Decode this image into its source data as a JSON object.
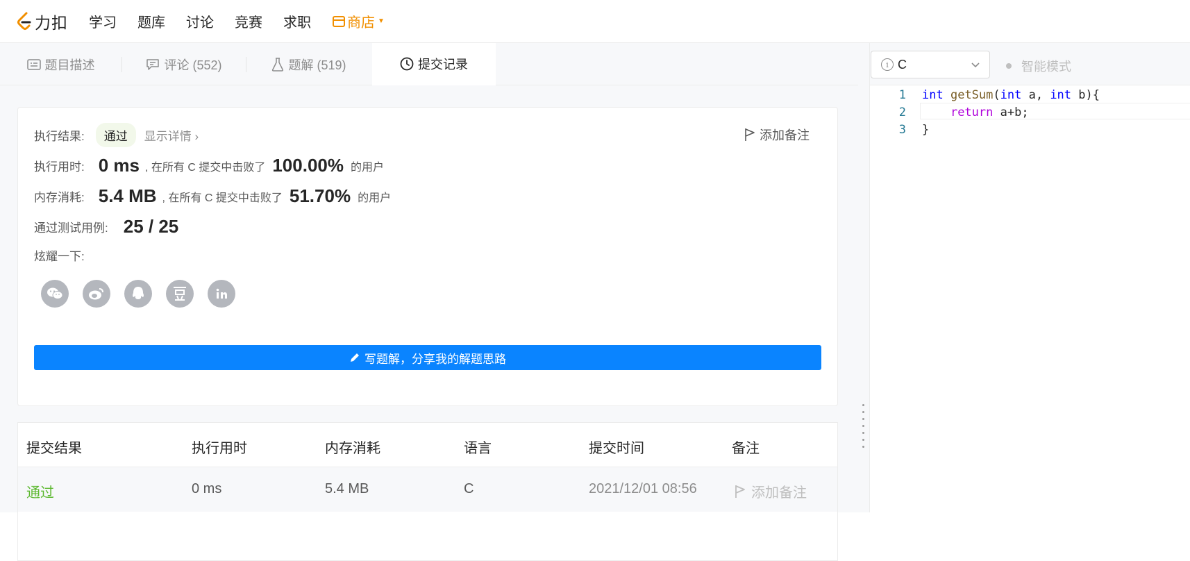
{
  "nav": {
    "logo_text": "力扣",
    "links": [
      "学习",
      "题库",
      "讨论",
      "竞赛",
      "求职"
    ],
    "store": "商店"
  },
  "tabs": {
    "description": "题目描述",
    "comments": "评论 (552)",
    "solutions": "题解 (519)",
    "submissions": "提交记录"
  },
  "result": {
    "exec_label": "执行结果:",
    "exec_status": "通过",
    "show_details": "显示详情",
    "add_note": "添加备注",
    "time_label": "执行用时:",
    "time_value": "0 ms",
    "time_text": ", 在所有 C 提交中击败了",
    "time_pct": "100.00%",
    "users": "的用户",
    "mem_label": "内存消耗:",
    "mem_value": "5.4 MB",
    "mem_text": ", 在所有 C 提交中击败了",
    "mem_pct": "51.70%",
    "cases_label": "通过测试用例:",
    "cases_value": "25 / 25",
    "share_label": "炫耀一下:",
    "share_icons": [
      "wechat-icon",
      "weibo-icon",
      "qq-icon",
      "douban-icon",
      "linkedin-icon"
    ],
    "write_button": "写题解，分享我的解题思路"
  },
  "table": {
    "headers": [
      "提交结果",
      "执行用时",
      "内存消耗",
      "语言",
      "提交时间",
      "备注"
    ],
    "rows": [
      {
        "result": "通过",
        "time": "0 ms",
        "memory": "5.4 MB",
        "language": "C",
        "submitted": "2021/12/01 08:56",
        "note": "添加备注"
      }
    ]
  },
  "editor": {
    "language": "C",
    "smart_mode": "智能模式",
    "line_numbers": [
      "1",
      "2",
      "3"
    ]
  },
  "colors": {
    "accent": "#0a84ff",
    "pass": "#5cb82f",
    "store": "#f18f00"
  }
}
